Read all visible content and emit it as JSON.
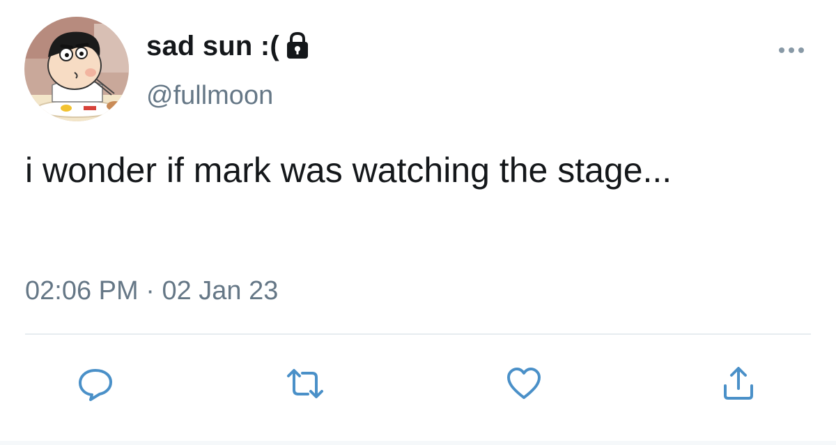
{
  "tweet": {
    "display_name": "sad sun :(",
    "handle": "@fullmoon",
    "text": "i wonder if mark was watching the stage...",
    "time": "02:06 PM",
    "separator": "·",
    "date": "02 Jan 23"
  },
  "icons": {
    "protected": "lock-icon",
    "more": "more-icon",
    "reply": "reply-icon",
    "retweet": "retweet-icon",
    "like": "heart-icon",
    "share": "share-icon"
  },
  "colors": {
    "text": "#14171a",
    "secondary": "#657786",
    "icon": "#4a90c8",
    "divider": "#e6ecf0"
  }
}
